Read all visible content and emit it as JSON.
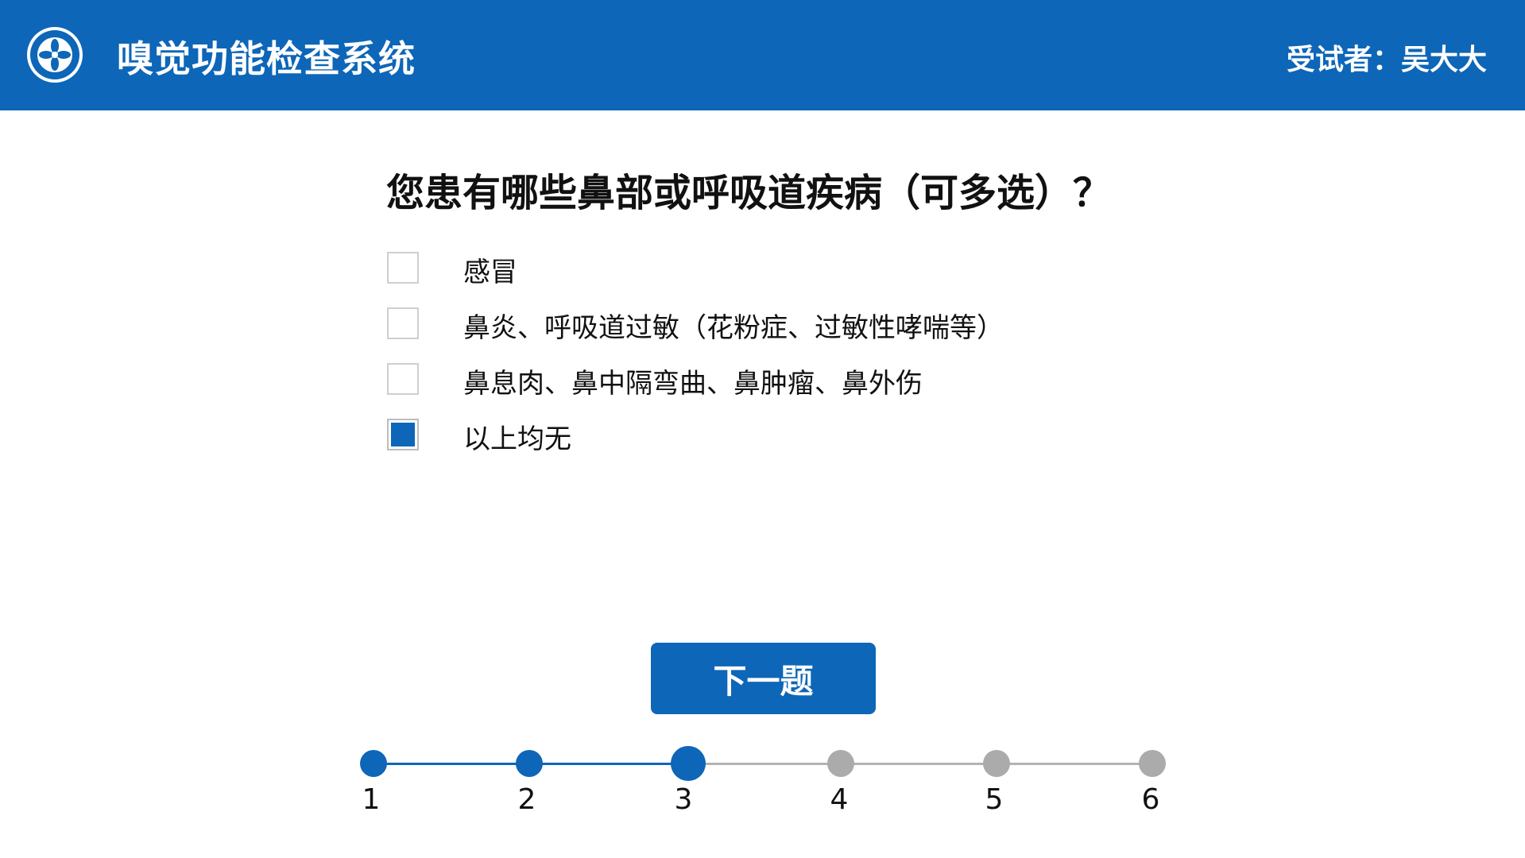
{
  "header": {
    "title": "嗅觉功能检查系统",
    "subject_label": "受试者：",
    "subject_name": "吴大大",
    "bg_color": "#0d66b8"
  },
  "question": {
    "text": "您患有哪些鼻部或呼吸道疾病（可多选）？",
    "options": [
      {
        "label": "感冒",
        "checked": false
      },
      {
        "label": "鼻炎、呼吸道过敏（花粉症、过敏性哮喘等）",
        "checked": false
      },
      {
        "label": "鼻息肉、鼻中隔弯曲、鼻肿瘤、鼻外伤",
        "checked": false
      },
      {
        "label": "以上均无",
        "checked": true
      }
    ]
  },
  "next_button": {
    "label": "下一题"
  },
  "progress": {
    "current": 3,
    "steps": [
      "1",
      "2",
      "3",
      "4",
      "5",
      "6"
    ]
  },
  "colors": {
    "accent": "#0d66b8",
    "inactive": "#ababab"
  }
}
